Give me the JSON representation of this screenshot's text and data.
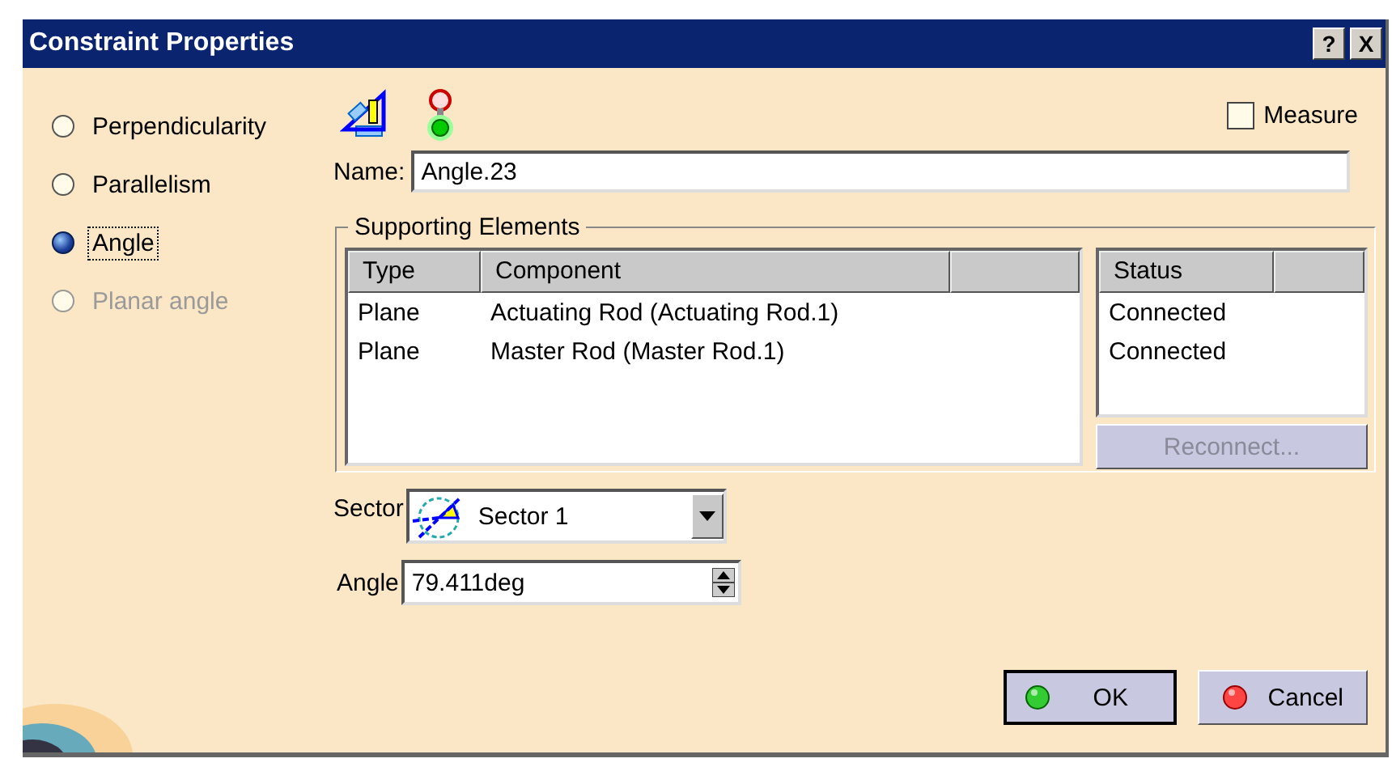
{
  "window": {
    "title": "Constraint Properties",
    "title_buttons": [
      "?",
      "X"
    ]
  },
  "constraint_types": [
    {
      "label": "Perpendicularity",
      "selected": false,
      "focused": false,
      "disabled": false
    },
    {
      "label": "Parallelism",
      "selected": false,
      "focused": false,
      "disabled": false
    },
    {
      "label": "Angle",
      "selected": true,
      "focused": true,
      "disabled": false
    },
    {
      "label": "Planar angle",
      "selected": false,
      "focused": false,
      "disabled": true
    }
  ],
  "measure": {
    "label": "Measure",
    "checked": false
  },
  "name": {
    "label": "Name:",
    "value": "Angle.23"
  },
  "supporting_elements": {
    "title": "Supporting Elements",
    "columns": [
      "Type",
      "Component"
    ],
    "rows": [
      [
        "Plane",
        "Actuating Rod (Actuating Rod.1)"
      ],
      [
        "Plane",
        "Master Rod (Master Rod.1)"
      ]
    ],
    "status_column": "Status",
    "status_rows": [
      "Connected",
      "Connected"
    ],
    "reconnect": {
      "label": "Reconnect...",
      "disabled": true
    }
  },
  "sector": {
    "label": "Sector",
    "value": "Sector 1"
  },
  "angle": {
    "label": "Angle",
    "value": "79.411deg"
  },
  "buttons": [
    {
      "label": "OK",
      "kind": "ok",
      "default": true
    },
    {
      "label": "Cancel",
      "kind": "cancel",
      "default": false
    }
  ]
}
